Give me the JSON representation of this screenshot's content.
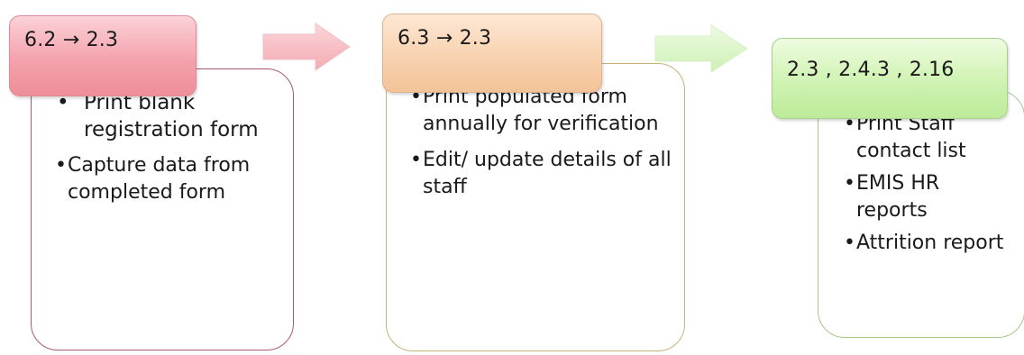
{
  "stages": [
    {
      "header": "6.2 → 2.3",
      "bullets": [
        "Print blank registration form",
        "Capture data from completed form"
      ],
      "colors": {
        "header": "#f4a2ac",
        "border": "#a85a66"
      }
    },
    {
      "header": "6.3 → 2.3",
      "bullets": [
        "Print populated form annually for verification",
        "Edit/ update details of all staff"
      ],
      "colors": {
        "header": "#f8d2b0",
        "border": "#c8b27a"
      }
    },
    {
      "header": "2.3 , 2.4.3 , 2.16",
      "bullets": [
        "Print Staff contact list",
        "EMIS HR reports",
        "Attrition report"
      ],
      "colors": {
        "header": "#cff3b2",
        "border": "#a7c98a"
      }
    }
  ],
  "arrows": [
    {
      "icon": "right-arrow-icon",
      "color": "#f5b5bb"
    },
    {
      "icon": "right-arrow-icon",
      "color": "#d6f5c0"
    }
  ]
}
